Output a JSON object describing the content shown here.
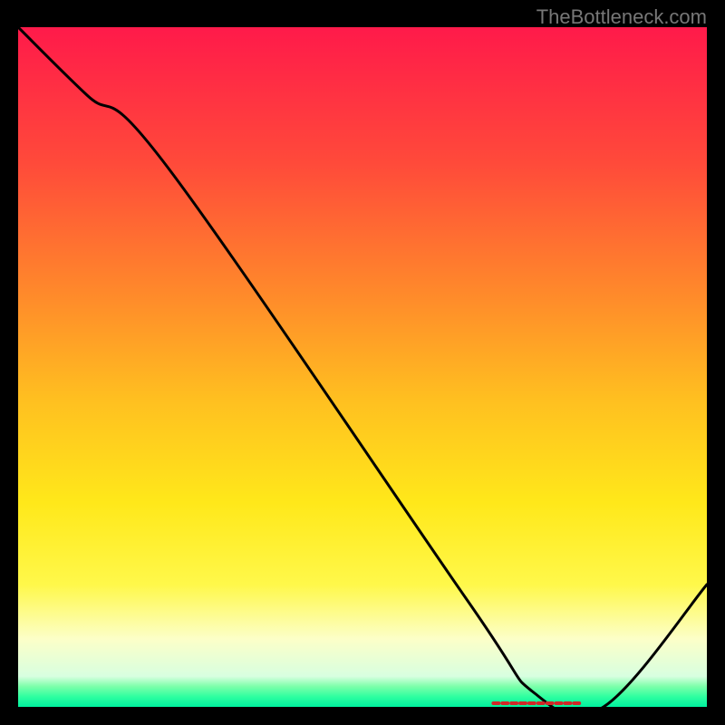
{
  "watermark": "TheBottleneck.com",
  "chart_data": {
    "type": "line",
    "title": "",
    "xlabel": "",
    "ylabel": "",
    "xlim": [
      0,
      100
    ],
    "ylim": [
      0,
      100
    ],
    "x": [
      0,
      10,
      22,
      65,
      75,
      85,
      100
    ],
    "values": [
      100,
      90,
      79,
      16,
      2,
      0,
      18
    ],
    "gradient_stops": [
      {
        "offset": 0.0,
        "color": "#ff1a4a"
      },
      {
        "offset": 0.2,
        "color": "#ff4a3a"
      },
      {
        "offset": 0.4,
        "color": "#ff8c2a"
      },
      {
        "offset": 0.55,
        "color": "#ffc020"
      },
      {
        "offset": 0.7,
        "color": "#ffe81a"
      },
      {
        "offset": 0.82,
        "color": "#fff84a"
      },
      {
        "offset": 0.9,
        "color": "#fcffc8"
      },
      {
        "offset": 0.955,
        "color": "#d8ffe0"
      },
      {
        "offset": 0.97,
        "color": "#7cffaa"
      },
      {
        "offset": 0.985,
        "color": "#2effa0"
      },
      {
        "offset": 1.0,
        "color": "#00f09e"
      }
    ],
    "marker": {
      "x_start": 69,
      "x_end": 82,
      "y": 0,
      "color": "#d02828"
    }
  },
  "colors": {
    "background": "#000000",
    "curve": "#000000",
    "watermark": "#777777"
  }
}
